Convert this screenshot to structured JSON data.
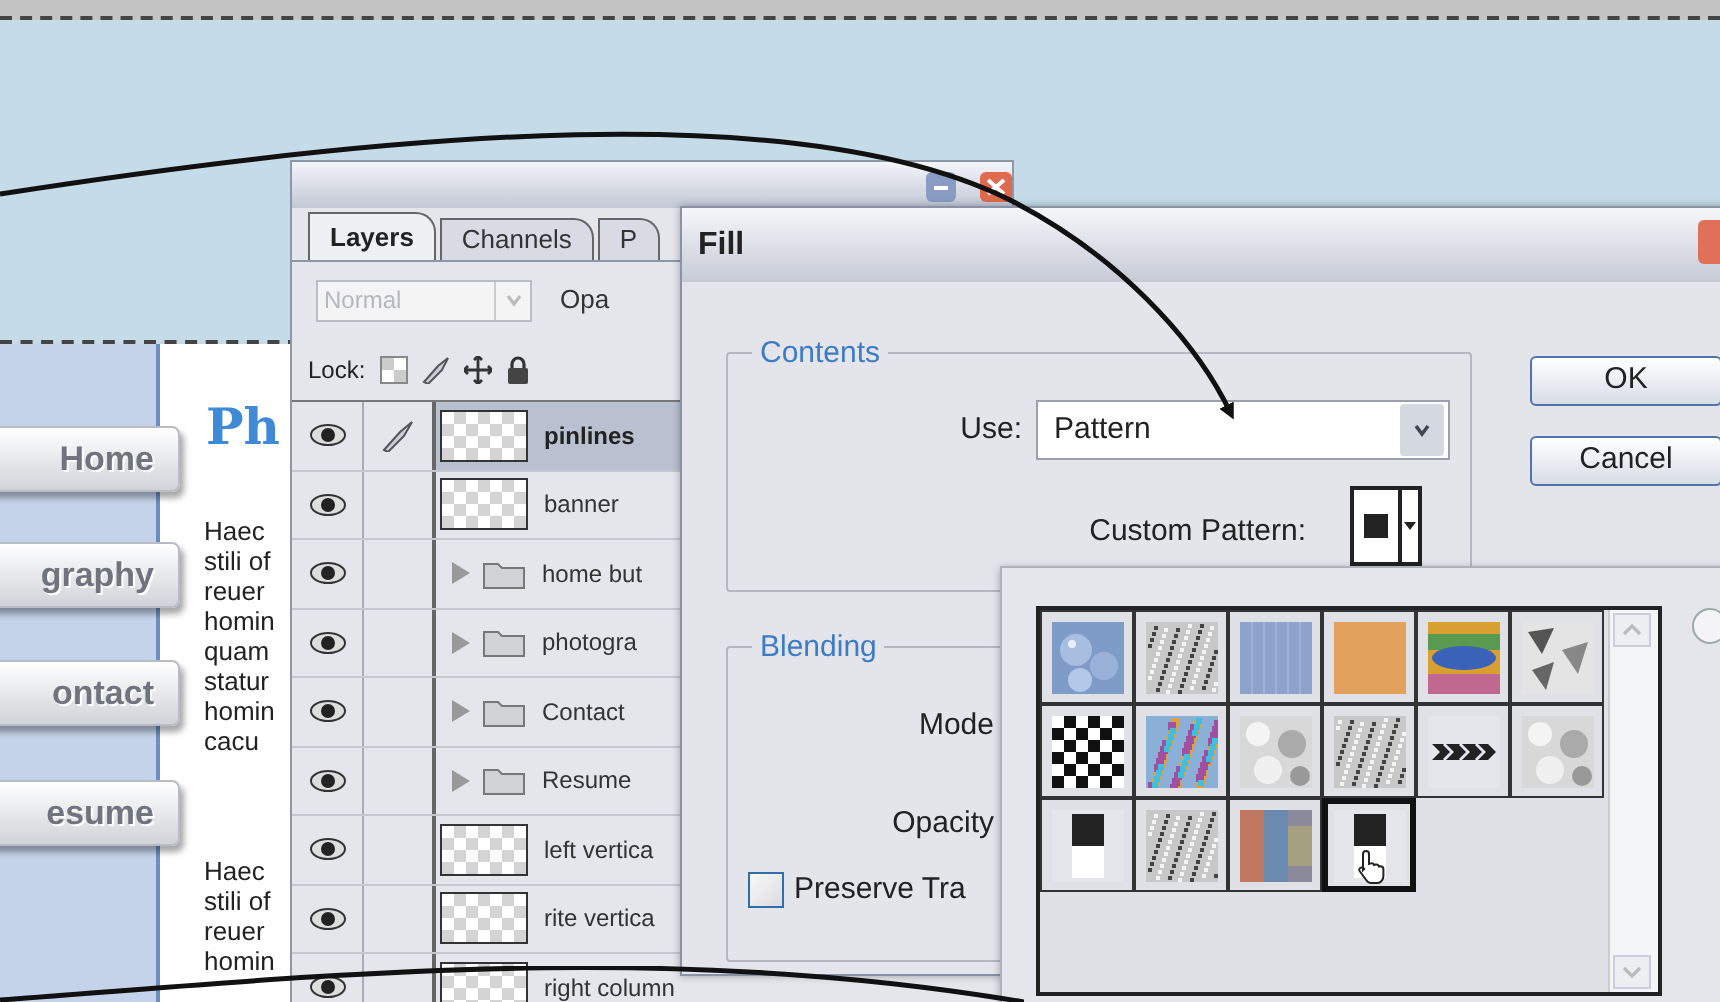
{
  "backdrop": {
    "nav_buttons": [
      "Home",
      "graphy",
      "ontact",
      "esume"
    ],
    "heading": "Ph",
    "paragraphs": [
      [
        "Haec",
        "stili of",
        "reuer",
        "homin",
        "quam",
        "statur",
        "homin",
        "cacu"
      ],
      [
        "Haec",
        "stili of",
        "reuer",
        "homin"
      ]
    ]
  },
  "layers_panel": {
    "tabs": [
      {
        "label": "Layers",
        "selected": true
      },
      {
        "label": "Channels",
        "selected": false
      },
      {
        "label": "P",
        "selected": false
      }
    ],
    "blend_mode": {
      "value": "Normal",
      "disabled": true
    },
    "opacity_label": "Opa",
    "lock_label": "Lock:",
    "layers": [
      {
        "kind": "layer",
        "name": "pinlines",
        "selected": true,
        "visible": true
      },
      {
        "kind": "layer",
        "name": "banner",
        "selected": false,
        "visible": true
      },
      {
        "kind": "group",
        "name": "home but",
        "selected": false,
        "visible": true
      },
      {
        "kind": "group",
        "name": "photogra",
        "selected": false,
        "visible": true
      },
      {
        "kind": "group",
        "name": "Contact",
        "selected": false,
        "visible": true
      },
      {
        "kind": "group",
        "name": "Resume",
        "selected": false,
        "visible": true
      },
      {
        "kind": "layer",
        "name": "left vertica",
        "selected": false,
        "visible": true
      },
      {
        "kind": "layer",
        "name": "rite vertica",
        "selected": false,
        "visible": true
      },
      {
        "kind": "layer",
        "name": "right column",
        "selected": false,
        "visible": true
      }
    ]
  },
  "fill_dialog": {
    "title": "Fill",
    "contents_label": "Contents",
    "use_label": "Use:",
    "use_value": "Pattern",
    "custom_pattern_label": "Custom Pattern:",
    "buttons": [
      "OK",
      "Cancel"
    ],
    "blending_label": "Blending",
    "mode_label": "Mode",
    "opacity_label": "Opacity",
    "preserve": {
      "label": "Preserve Tra",
      "checked": false
    }
  },
  "pattern_picker": {
    "patterns": [
      {
        "kind": "bubbles",
        "selected": false
      },
      {
        "kind": "gravel",
        "selected": false
      },
      {
        "kind": "blue-weave",
        "selected": false
      },
      {
        "kind": "orange",
        "selected": false
      },
      {
        "kind": "rainbow",
        "selected": false
      },
      {
        "kind": "shards",
        "selected": false
      },
      {
        "kind": "checker",
        "selected": false
      },
      {
        "kind": "confetti",
        "selected": false
      },
      {
        "kind": "clouds",
        "selected": false
      },
      {
        "kind": "gravel",
        "selected": false
      },
      {
        "kind": "arrows",
        "selected": false
      },
      {
        "kind": "clouds",
        "selected": false
      },
      {
        "kind": "black-white",
        "selected": false
      },
      {
        "kind": "gravel",
        "selected": false
      },
      {
        "kind": "blur",
        "selected": false
      },
      {
        "kind": "black-white",
        "selected": true
      }
    ]
  }
}
